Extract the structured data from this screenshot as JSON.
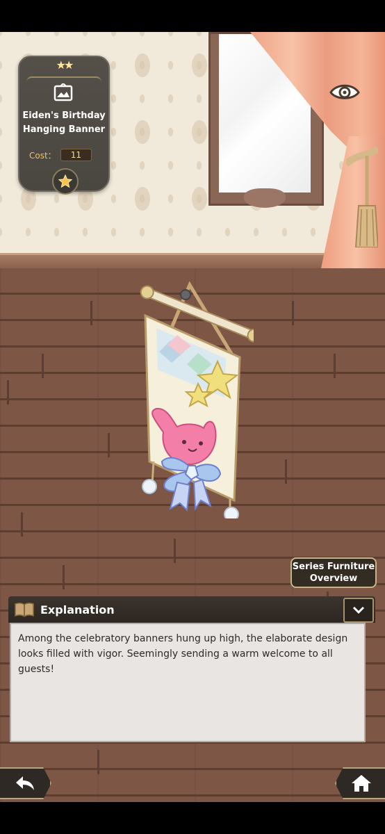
{
  "item_card": {
    "stars": "★★",
    "name": "Eiden's Birthday Hanging Banner",
    "cost_label": "Cost：",
    "cost_value": "11"
  },
  "series_button": {
    "label": "Series Furniture Overview"
  },
  "explanation": {
    "title": "Explanation",
    "body": "Among the celebratory banners hung up high, the elaborate design looks filled with vigor. Seemingly sending a warm welcome to all guests!"
  },
  "icons": {
    "eye": "eye-icon",
    "frame": "picture-frame-icon",
    "star": "star-icon",
    "book": "book-icon",
    "chevron": "chevron-down-icon",
    "back": "back-arrow-icon",
    "home": "home-icon"
  },
  "colors": {
    "panel_dark": "#2d2621",
    "gold_accent": "#f4c35d",
    "text_body": "#2d2a27"
  }
}
